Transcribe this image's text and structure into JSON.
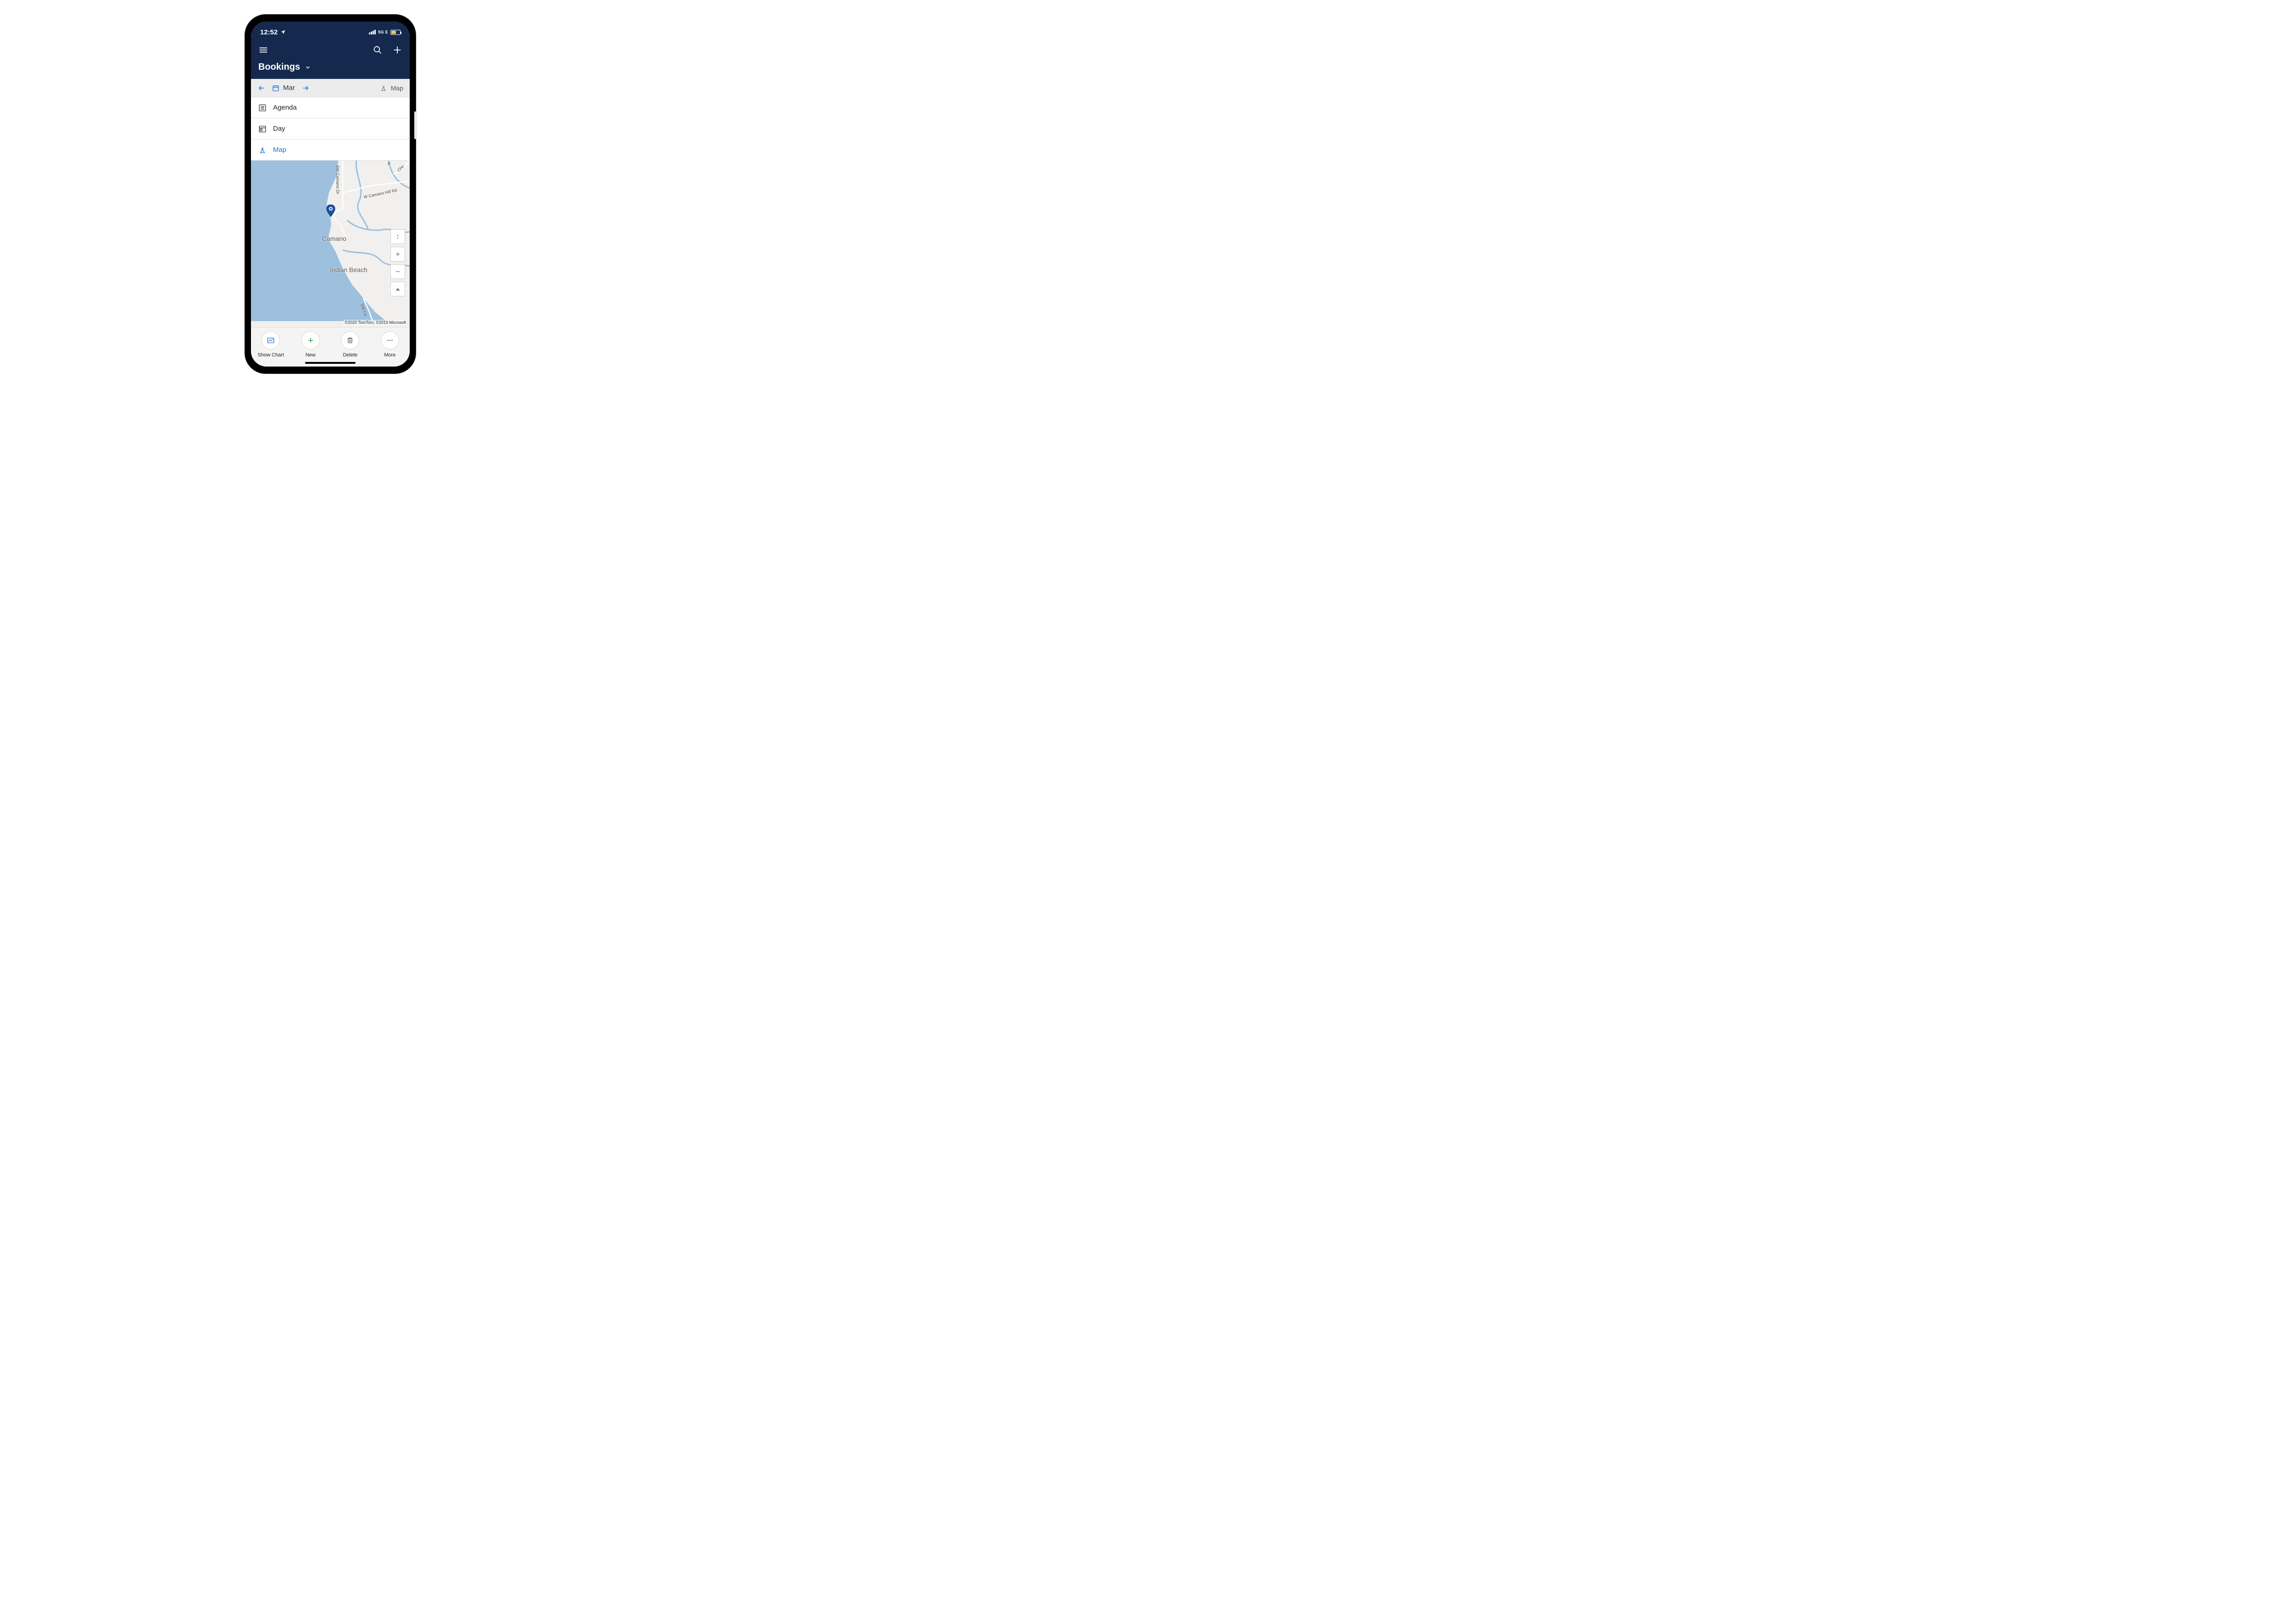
{
  "status": {
    "time": "12:52",
    "network": "5G E"
  },
  "header": {
    "title": "Bookings"
  },
  "subheader": {
    "month": "Mar",
    "map_toggle": "Map"
  },
  "view_options": {
    "agenda": "Agenda",
    "day": "Day",
    "map": "Map"
  },
  "map": {
    "places": {
      "camano": "Camano",
      "indian_beach": "Indian Beach"
    },
    "roads": {
      "sw_camano_dr": "SW Camano Dr",
      "w_camano_hill_rd": "W Camano Hill Rd",
      "w_mo": "W Mo",
      "che": "Che",
      "p": "P",
      "sw_ca": "SW Ca"
    },
    "attribution": "©2020 TomTom, ©2019 Microsoft"
  },
  "bottom_bar": {
    "show_chart": "Show Chart",
    "new": "New",
    "delete": "Delete",
    "more": "More"
  }
}
